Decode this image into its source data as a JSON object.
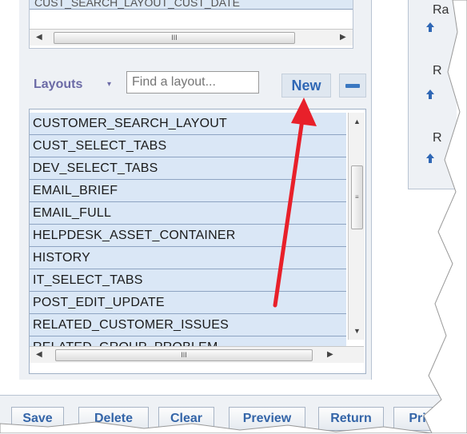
{
  "top_list": {
    "partial_row": "CUST_SEARCH_LAYOUT_CUST_DATE"
  },
  "hscroll_thumb": "III",
  "toolbar": {
    "layouts_label": "Layouts",
    "caret": "▾",
    "find_placeholder": "Find a layout...",
    "new_label": "New"
  },
  "layouts": [
    "CUSTOMER_SEARCH_LAYOUT",
    "CUST_SELECT_TABS",
    "DEV_SELECT_TABS",
    "EMAIL_BRIEF",
    "EMAIL_FULL",
    "HELPDESK_ASSET_CONTAINER",
    "HISTORY",
    "IT_SELECT_TABS",
    "POST_EDIT_UPDATE",
    "RELATED_CUSTOMER_ISSUES",
    "RELATED_GROUP_PROBLEM"
  ],
  "right_panel": {
    "texts": [
      "Ra",
      "R",
      "R"
    ]
  },
  "bottom_buttons": {
    "save": "Save",
    "delete": "Delete",
    "clear": "Clear",
    "preview": "Preview",
    "return": "Return",
    "print": "Pri"
  },
  "colors": {
    "accent": "#2f67b5",
    "annotation_arrow": "#e8202a",
    "row_fill": "#dae7f6"
  }
}
